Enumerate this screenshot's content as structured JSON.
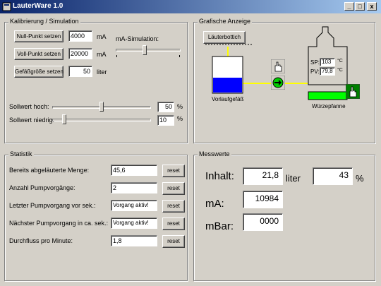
{
  "window": {
    "title": "LauterWare 1.0",
    "controls": {
      "minimize": "_",
      "maximize": "□",
      "close": "x"
    }
  },
  "kalibrierung": {
    "title": "Kalibrierung / Simulation",
    "null_punkt_button": "Null-Punkt setzen",
    "null_punkt_value": "4000",
    "null_punkt_unit": "mA",
    "voll_punkt_button": "Voll-Punkt setzen",
    "voll_punkt_value": "20000",
    "voll_punkt_unit": "mA",
    "gefaess_button": "Gefäßgröße setzen",
    "gefaess_value": "50",
    "gefaess_unit": "liter",
    "ma_simulation_label": "mA-Simulation:",
    "sollwert_hoch_label": "Sollwert hoch:",
    "sollwert_hoch_value": "50",
    "sollwert_hoch_unit": "%",
    "sollwert_niedrig_label": "Sollwert niedrig:",
    "sollwert_niedrig_value": "10",
    "sollwert_niedrig_unit": "%"
  },
  "grafik": {
    "title": "Grafische Anzeige",
    "lauterbottich_label": "Läuterbottich",
    "vorlauf_label": "Vorlaufgefäß",
    "wuerze_label": "Würzepfanne",
    "sp_label": "SP:",
    "sp_value": "103",
    "sp_unit": "°C",
    "pv_label": "PV:",
    "pv_value": "79,8",
    "pv_unit": "°C",
    "vorlauf_fill_fraction": 0.42,
    "colors": {
      "pipe": "#ffff00",
      "vessel_fill": "#0000ff",
      "pan_fill": "#00ff00",
      "pump": "#00cc00"
    }
  },
  "statistik": {
    "title": "Statistik",
    "reset_label": "reset",
    "rows": [
      {
        "label": "Bereits abgeläuterte Menge:",
        "value": "45,6"
      },
      {
        "label": "Anzahl Pumpvorgänge:",
        "value": "2"
      },
      {
        "label": "Letzter Pumpvorgang vor sek.:",
        "value": "Vorgang aktiv!"
      },
      {
        "label": "Nächster Pumpvorgang in ca. sek.:",
        "value": "Vorgang aktiv!"
      },
      {
        "label": "Durchfluss pro Minute:",
        "value": "1,8"
      }
    ]
  },
  "messwerte": {
    "title": "Messwerte",
    "inhalt_label": "Inhalt:",
    "inhalt_value": "21,8",
    "inhalt_unit": "liter",
    "percent_value": "43",
    "percent_unit": "%",
    "ma_label": "mA:",
    "ma_value": "10984",
    "mbar_label": "mBar:",
    "mbar_value": "0000"
  }
}
